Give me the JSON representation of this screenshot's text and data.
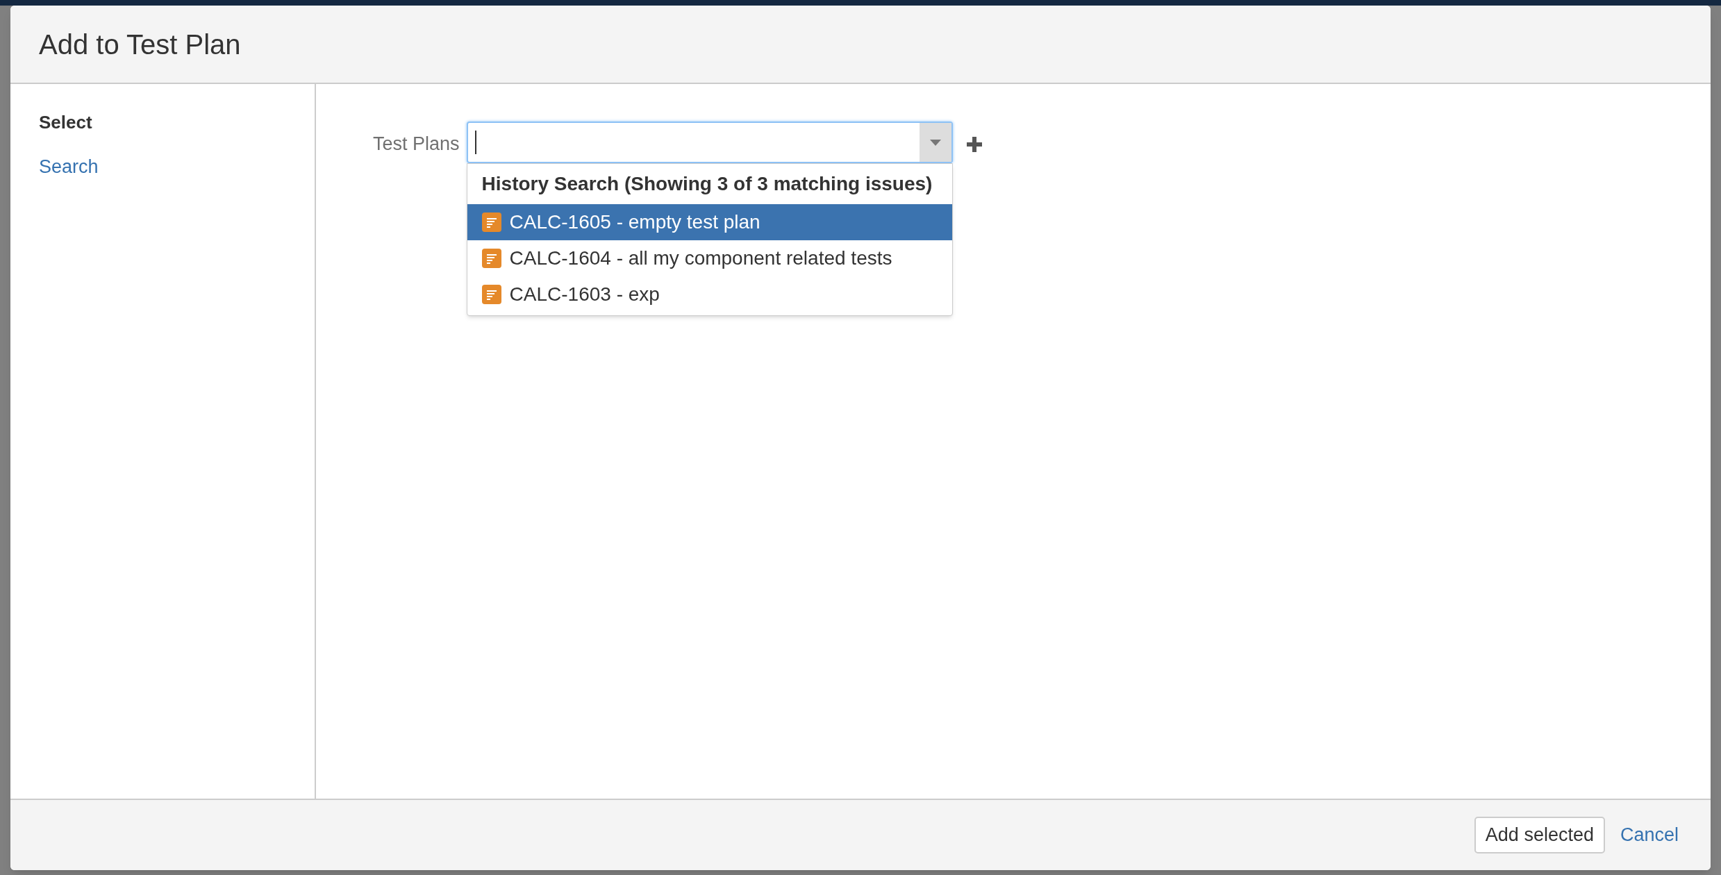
{
  "dialog": {
    "title": "Add to Test Plan",
    "sidebar": {
      "heading": "Select",
      "items": [
        {
          "label": "Search"
        }
      ]
    },
    "field": {
      "label": "Test Plans",
      "focused": true
    },
    "dropdown": {
      "heading": "History Search (Showing 3 of 3 matching issues)",
      "items": [
        {
          "label": "CALC-1605 - empty test plan",
          "selected": true
        },
        {
          "label": "CALC-1604 - all my component related tests",
          "selected": false
        },
        {
          "label": "CALC-1603 - exp",
          "selected": false
        }
      ]
    },
    "buttons": [
      {
        "label": "Add selected",
        "kind": "button"
      },
      {
        "label": "Cancel",
        "kind": "link"
      }
    ]
  }
}
